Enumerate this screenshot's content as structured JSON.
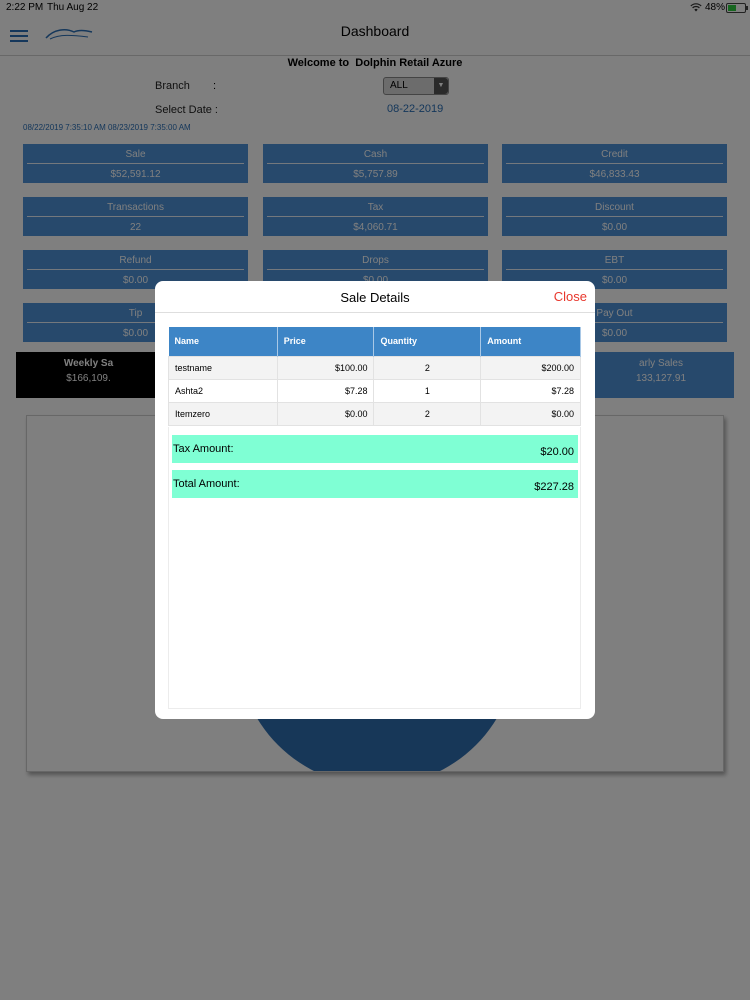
{
  "status_bar": {
    "time": "2:22 PM",
    "date": "Thu Aug 22",
    "battery": "48%"
  },
  "header": {
    "title": "Dashboard"
  },
  "dashboard": {
    "welcome_prefix": "Welcome to",
    "store_name": "Dolphin Retail Azure",
    "branch_label": "Branch",
    "branch_colon": ":",
    "branch_value": "ALL",
    "date_label": "Select Date :",
    "date_value": "08-22-2019",
    "date_range": "08/22/2019 7:35:10 AM 08/23/2019 7:35:00 AM",
    "tiles": [
      {
        "label": "Sale",
        "value": "$52,591.12"
      },
      {
        "label": "Cash",
        "value": "$5,757.89"
      },
      {
        "label": "Credit",
        "value": "$46,833.43"
      },
      {
        "label": "Transactions",
        "value": "22"
      },
      {
        "label": "Tax",
        "value": "$4,060.71"
      },
      {
        "label": "Discount",
        "value": "$0.00"
      },
      {
        "label": "Refund",
        "value": "$0.00"
      },
      {
        "label": "Drops",
        "value": "$0.00"
      },
      {
        "label": "EBT",
        "value": "$0.00"
      },
      {
        "label": "Tip",
        "value": "$0.00"
      },
      {
        "label": "Pay Out",
        "value": "$0.00"
      }
    ],
    "weekly_sales": {
      "label": "Weekly Sa",
      "value": "$166,109."
    },
    "yearly_sales": {
      "label": "arly Sales",
      "value": "133,127.91"
    }
  },
  "modal": {
    "title": "Sale Details",
    "close_label": "Close",
    "columns": [
      "Name",
      "Price",
      "Quantity",
      "Amount"
    ],
    "rows": [
      {
        "name": "testname",
        "price": "$100.00",
        "quantity": "2",
        "amount": "$200.00"
      },
      {
        "name": "Ashta2",
        "price": "$7.28",
        "quantity": "1",
        "amount": "$7.28"
      },
      {
        "name": "Itemzero",
        "price": "$0.00",
        "quantity": "2",
        "amount": "$0.00"
      }
    ],
    "tax_label": "Tax Amount:",
    "tax_value": "$20.00",
    "total_label": "Total Amount:",
    "total_value": "$227.28"
  },
  "colors": {
    "accent": "#3d85c6",
    "tile": "#4f93d8",
    "summary": "#7fffd4",
    "close": "#e8372c"
  }
}
